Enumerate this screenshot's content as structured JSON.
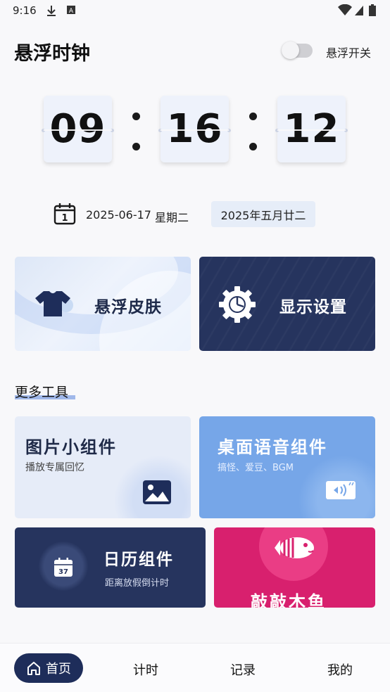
{
  "status_bar": {
    "time": "9:16"
  },
  "header": {
    "title": "悬浮时钟",
    "toggle_label": "悬浮开关",
    "toggle_on": false
  },
  "clock": {
    "hours": "09",
    "minutes": "16",
    "seconds": "12"
  },
  "date_row": {
    "date": "2025-06-17",
    "weekday": "星期二",
    "lunar": "2025年五月廿二",
    "calendar_day": "1"
  },
  "top_cards": {
    "skin_label": "悬浮皮肤",
    "display_label": "显示设置"
  },
  "more_tools": {
    "section_title": "更多工具",
    "photo_widget": {
      "title": "图片小组件",
      "subtitle": "播放专属回忆"
    },
    "voice_widget": {
      "title": "桌面语音组件",
      "subtitle": "搞怪、爱豆、BGM"
    },
    "calendar_widget": {
      "title": "日历组件",
      "subtitle": "距离放假倒计时",
      "icon_text": "37"
    },
    "fish_widget": {
      "title": "敲敲木鱼"
    }
  },
  "bottom_nav": {
    "home": "首页",
    "timer": "计时",
    "records": "记录",
    "mine": "我的"
  },
  "colors": {
    "accent_dark": "#1e2d5a",
    "accent_blue": "#76a6e8",
    "accent_pink": "#d8206e"
  }
}
